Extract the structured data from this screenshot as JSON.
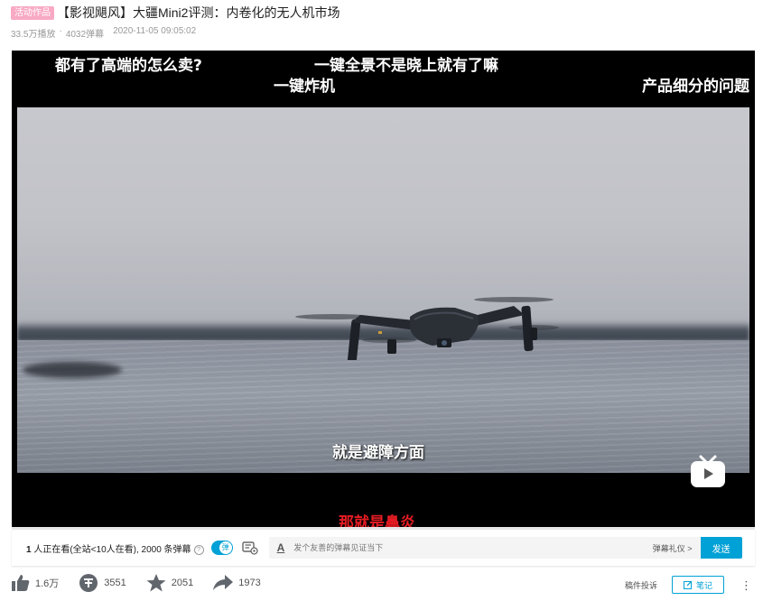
{
  "video": {
    "tag": "活动作品",
    "title": "【影视飓风】大疆Mini2评测：内卷化的无人机市场",
    "plays": "33.5万播放",
    "separator": "·",
    "danmaku_count": "4032弹幕",
    "date": "2020-11-05 09:05:02"
  },
  "player": {
    "danmaku": [
      "都有了高端的怎么卖?",
      "一键全景不是晓上就有了嘛",
      "一键炸机",
      "产品细分的问题",
      "那就是鼻炎"
    ],
    "subtitle": "就是避障方面",
    "progress": 0.0
  },
  "controls": {
    "viewers_count": "1",
    "viewers_text": "人正在看(全站<10人在看), 2000 条弹幕",
    "help": "?",
    "toggle_label": "弹",
    "font_icon": "A",
    "input_placeholder": "发个友善的弹幕见证当下",
    "etiquette": "弹幕礼仪 >",
    "send": "发送"
  },
  "actions": {
    "like": "1.6万",
    "coin": "3551",
    "favorite": "2051",
    "share": "1973",
    "report": "稿件投诉",
    "note": "笔记",
    "more": "⋮"
  },
  "colors": {
    "accent": "#00a1d6",
    "tag": "#f8a9c3",
    "danmaku_red": "#e51c23"
  }
}
